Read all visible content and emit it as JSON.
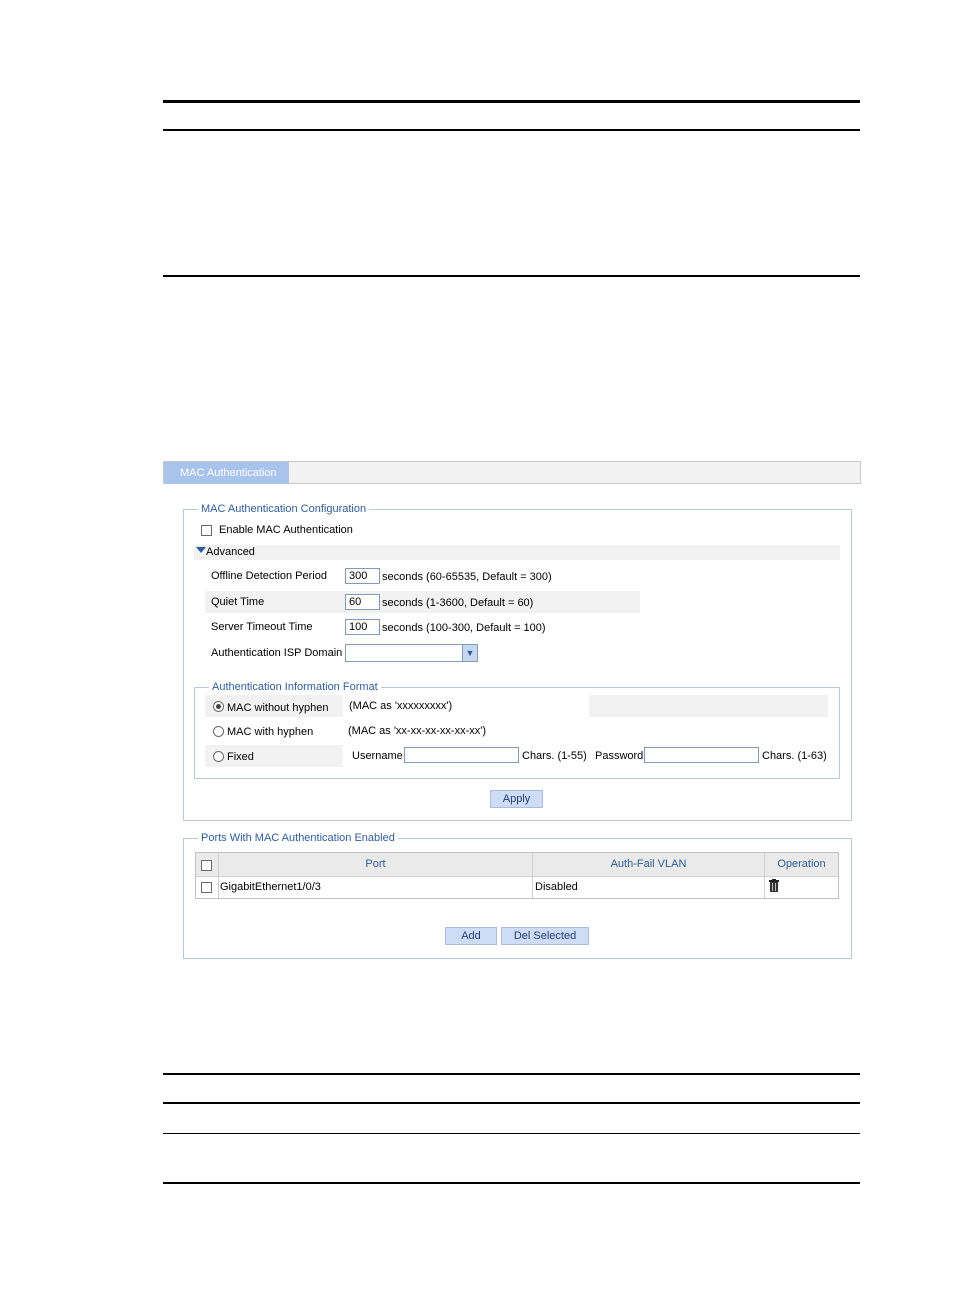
{
  "tab": {
    "label": "MAC Authentication"
  },
  "config": {
    "legend": "MAC Authentication Configuration",
    "enable_label": "Enable MAC Authentication",
    "advanced_label": "Advanced",
    "rows": [
      {
        "label": "Offline Detection Period",
        "value": "300",
        "hint": "seconds (60-65535, Default = 300)"
      },
      {
        "label": "Quiet Time",
        "value": "60",
        "hint": "seconds (1-3600, Default = 60)"
      },
      {
        "label": "Server Timeout Time",
        "value": "100",
        "hint": "seconds (100-300, Default = 100)"
      }
    ],
    "isp_label": "Authentication ISP Domain",
    "isp_value": "",
    "format": {
      "legend": "Authentication Information Format",
      "without_hyphen": {
        "label": "MAC without hyphen",
        "desc": "(MAC as 'xxxxxxxxx')",
        "selected": true
      },
      "with_hyphen": {
        "label": "MAC with hyphen",
        "desc": "(MAC as 'xx-xx-xx-xx-xx-xx')",
        "selected": false
      },
      "fixed": {
        "label": "Fixed",
        "username_label": "Username",
        "username_value": "",
        "username_hint": "Chars. (1-55)",
        "password_label": "Password",
        "password_value": "",
        "password_hint": "Chars. (1-63)",
        "selected": false
      }
    },
    "apply_label": "Apply"
  },
  "ports": {
    "legend": "Ports With MAC Authentication Enabled",
    "columns": [
      "Port",
      "Auth-Fail VLAN",
      "Operation"
    ],
    "rows": [
      {
        "port": "GigabitEthernet1/0/3",
        "vlan": "Disabled",
        "operation_icon": "trash-icon"
      }
    ],
    "add_label": "Add",
    "del_label": "Del Selected"
  },
  "colors": {
    "tab": "#a9c4ec",
    "legend_text": "#2f5d9a",
    "button": "#cfdcf5",
    "fieldset_border": "#b9c9de"
  }
}
